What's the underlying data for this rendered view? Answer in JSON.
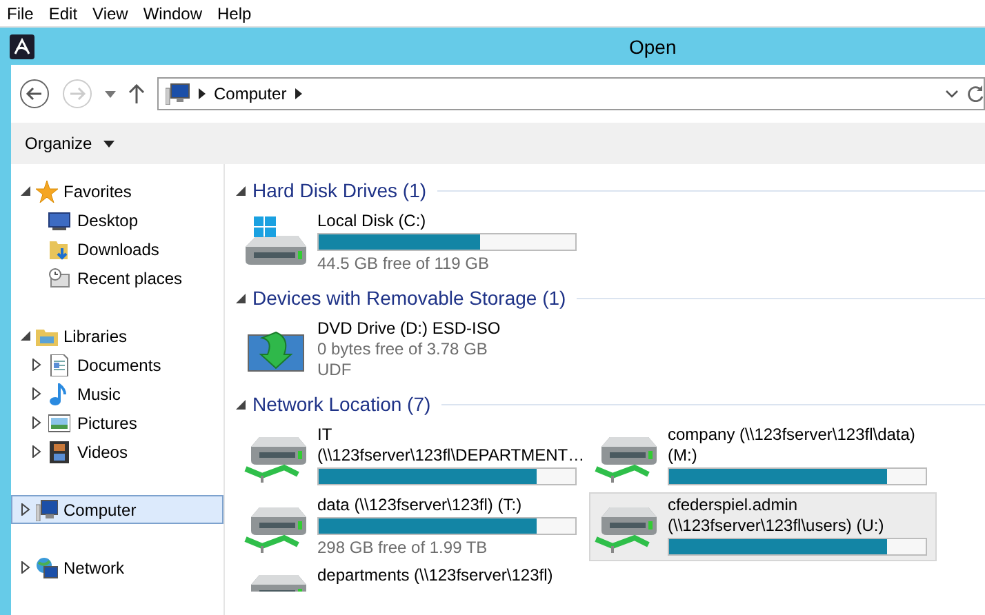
{
  "menu": [
    "File",
    "Edit",
    "View",
    "Window",
    "Help"
  ],
  "window": {
    "title": "Open"
  },
  "address": {
    "crumbs": [
      "Computer"
    ]
  },
  "toolbar": {
    "organize": "Organize"
  },
  "sidebar": {
    "items": [
      {
        "label": "Favorites",
        "kind": "star",
        "expanded": true,
        "selected": false,
        "children": [
          {
            "label": "Desktop",
            "kind": "desktop",
            "selected": false
          },
          {
            "label": "Downloads",
            "kind": "downloads",
            "selected": false
          },
          {
            "label": "Recent places",
            "kind": "recent",
            "selected": false
          }
        ]
      },
      {
        "label": "Libraries",
        "kind": "library",
        "expanded": true,
        "selected": false,
        "children": [
          {
            "label": "Documents",
            "kind": "document",
            "expanded": false,
            "selected": false
          },
          {
            "label": "Music",
            "kind": "music",
            "expanded": false,
            "selected": false
          },
          {
            "label": "Pictures",
            "kind": "pictures",
            "expanded": false,
            "selected": false
          },
          {
            "label": "Videos",
            "kind": "videos",
            "expanded": false,
            "selected": false
          }
        ]
      },
      {
        "label": "Computer",
        "kind": "computer",
        "expanded": false,
        "selected": true
      },
      {
        "label": "Network",
        "kind": "network",
        "expanded": false,
        "selected": false
      }
    ]
  },
  "sections": [
    {
      "title": "Hard Disk Drives (1)",
      "expanded": true,
      "kind": "single",
      "drives": [
        {
          "kind": "hdd",
          "name": [
            "Local Disk (C:)"
          ],
          "level": 0.63,
          "details": [
            "44.5 GB free of 119 GB"
          ],
          "selected": false
        }
      ]
    },
    {
      "title": "Devices with Removable Storage (1)",
      "expanded": true,
      "kind": "single",
      "drives": [
        {
          "kind": "dvd",
          "name": [
            "DVD Drive (D:) ESD-ISO"
          ],
          "details": [
            "0 bytes free of 3.78 GB",
            "UDF"
          ],
          "selected": false
        }
      ]
    },
    {
      "title": "Network Location (7)",
      "expanded": true,
      "kind": "double",
      "drives": [
        {
          "kind": "network",
          "name": [
            "IT",
            "(\\\\123fserver\\123fl\\DEPARTMENT…"
          ],
          "level": 0.85,
          "selected": false
        },
        {
          "kind": "network",
          "name": [
            "company (\\\\123fserver\\123fl\\data)",
            "(M:)"
          ],
          "level": 0.85,
          "selected": false
        },
        {
          "kind": "network",
          "name": [
            "data (\\\\123fserver\\123fl) (T:)"
          ],
          "level": 0.85,
          "details": [
            "298 GB free of 1.99 TB"
          ],
          "selected": false
        },
        {
          "kind": "network",
          "name": [
            "cfederspiel.admin",
            "(\\\\123fserver\\123fl\\users) (U:)"
          ],
          "level": 0.85,
          "selected": true
        },
        {
          "kind": "network",
          "name": [
            "departments (\\\\123fserver\\123fl)"
          ],
          "selected": false
        }
      ]
    }
  ]
}
